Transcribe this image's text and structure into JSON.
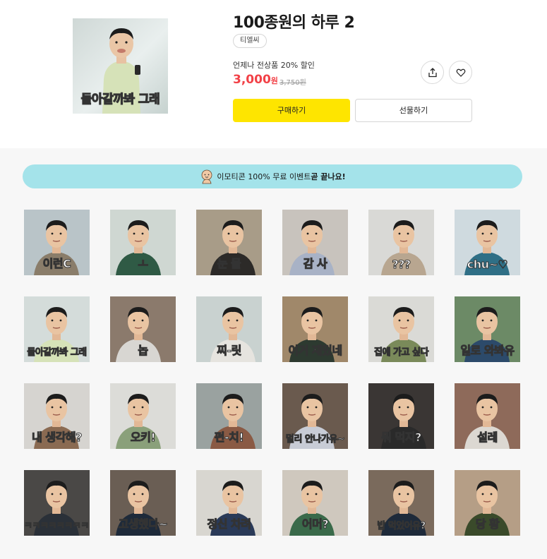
{
  "product": {
    "title": "100종원의 하루 2",
    "author": "티엘씨",
    "promo": "언제나 전상품 20% 할인",
    "price": "3,000",
    "price_unit": "원",
    "original_price": "3,750원",
    "thumbnail_caption": "돌아갈까봐 그래",
    "buy_label": "구매하기",
    "gift_label": "선물하기"
  },
  "banner": {
    "text_prefix": "이모티콘 100% 무료 이벤트 ",
    "text_emphasis": "곧 끝나요!"
  },
  "colors": {
    "accent_yellow": "#fee500",
    "price_red": "#f24147",
    "banner_bg": "#a4e3ea"
  },
  "stickers": [
    {
      "label": "이런C",
      "bg": "#b9c4c8",
      "shirt": "#8a7d6a"
    },
    {
      "label": "ㅗ",
      "bg": "#cfd7d2",
      "shirt": "#2f5a45"
    },
    {
      "label": "눈 물",
      "bg": "#a89c88",
      "shirt": "#2c2a28"
    },
    {
      "label": "감 사",
      "bg": "#c8c3bd",
      "shirt": "#a8b2c6"
    },
    {
      "label": "???",
      "bg": "#d9d9d6",
      "shirt": "#b8a690"
    },
    {
      "label": "chu~♡",
      "bg": "#cfdadf",
      "shirt": "#2f6f86"
    },
    {
      "label": "돌아갈까봐 그래",
      "bg": "#d4dcda",
      "shirt": "#d6e2b8"
    },
    {
      "label": "놉",
      "bg": "#8b7a6c",
      "shirt": "#d8d6d2"
    },
    {
      "label": "찌-릿",
      "bg": "#c9d2d0",
      "shirt": "#e6e4df"
    },
    {
      "label": "이거 재밌네",
      "bg": "#a0886a",
      "shirt": "#2d3a30"
    },
    {
      "label": "집에 가고 싶다",
      "bg": "#dadad6",
      "shirt": "#7a8a5a"
    },
    {
      "label": "일로 와봐유",
      "bg": "#6c8a66",
      "shirt": "#2c4a6a"
    },
    {
      "label": "내 생각해?",
      "bg": "#d6d4d0",
      "shirt": "#8a6a52"
    },
    {
      "label": "오키!",
      "bg": "#dcdcd8",
      "shirt": "#8aa07a"
    },
    {
      "label": "펀-치!",
      "bg": "#9aa2a0",
      "shirt": "#8a5a44"
    },
    {
      "label": "멀리 안나가유~",
      "bg": "#6a5a4e",
      "shirt": "#c8ccd6"
    },
    {
      "label": "뭐 먹지?",
      "bg": "#3a3634",
      "shirt": "#2a2a2a"
    },
    {
      "label": "설레",
      "bg": "#8e6a5a",
      "shirt": "#dcd8d2"
    },
    {
      "label": "ㅋㅋㅋㅋㅋㅋㅋㅋㅋ",
      "bg": "#4a4846",
      "shirt": "#2a3038"
    },
    {
      "label": "고생했다~",
      "bg": "#6a5e54",
      "shirt": "#1e2a3a"
    },
    {
      "label": "정신 차려",
      "bg": "#d8d6d0",
      "shirt": "#2a3a58"
    },
    {
      "label": "어머?",
      "bg": "#cfc8be",
      "shirt": "#3a6a4a"
    },
    {
      "label": "밥 먹었어유?",
      "bg": "#7a6a5c",
      "shirt": "#1e2a3a"
    },
    {
      "label": "당 황",
      "bg": "#b59e86",
      "shirt": "#3a4a2a"
    }
  ]
}
